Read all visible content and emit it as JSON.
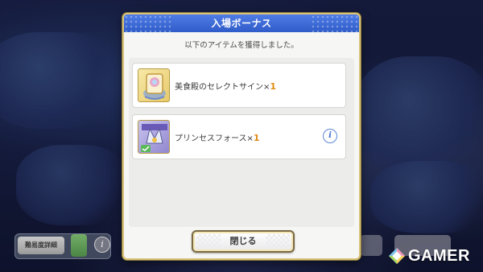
{
  "dialog": {
    "title": "入場ボーナス",
    "subtitle": "以下のアイテムを獲得しました。",
    "items": [
      {
        "name": "美食殿のセレクトサイン",
        "multiplier": "×",
        "quantity": "1",
        "icon": "select-sign-icon"
      },
      {
        "name": "プリンセスフォース",
        "multiplier": "×",
        "quantity": "1",
        "icon": "princess-force-icon",
        "info": "i"
      }
    ],
    "close_label": "閉じる"
  },
  "background": {
    "difficulty_label": "難易度詳細",
    "info_glyph": "i"
  },
  "watermark": {
    "text": "GAMER"
  },
  "colors": {
    "header_blue": "#3d6bd8",
    "quantity_orange": "#e08a12",
    "frame_gold": "#d8c27a"
  }
}
